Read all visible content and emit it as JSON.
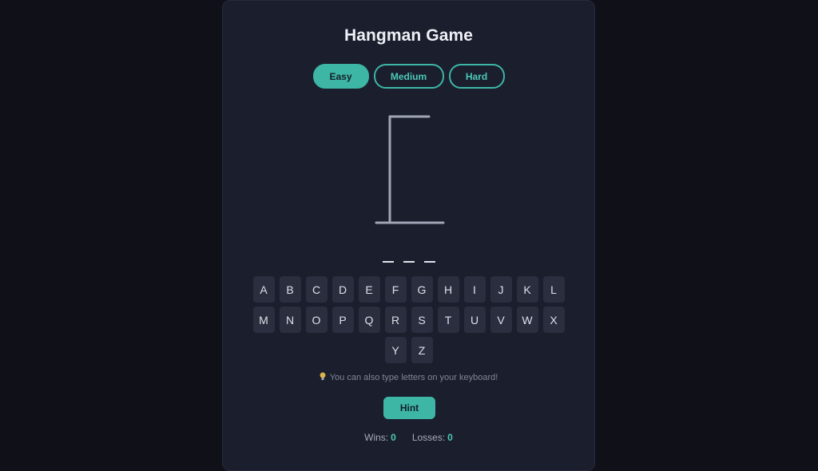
{
  "game": {
    "title": "Hangman Game"
  },
  "difficulty": {
    "options": [
      "Easy",
      "Medium",
      "Hard"
    ],
    "selected": "Easy"
  },
  "word": {
    "letters": [
      "",
      "",
      ""
    ]
  },
  "keyboard": {
    "rows": [
      [
        "A",
        "B",
        "C",
        "D",
        "E",
        "F",
        "G",
        "H",
        "I",
        "J",
        "K",
        "L"
      ],
      [
        "M",
        "N",
        "O",
        "P",
        "Q",
        "R",
        "S",
        "T",
        "U",
        "V",
        "W",
        "X"
      ],
      [
        "Y",
        "Z"
      ]
    ]
  },
  "tip": {
    "icon": "lightbulb-icon",
    "text": "You can also type letters on your keyboard!"
  },
  "hint": {
    "label": "Hint"
  },
  "score": {
    "wins_label": "Wins:",
    "wins": "0",
    "losses_label": "Losses:",
    "losses": "0"
  },
  "colors": {
    "accent": "#3db6a6",
    "background": "#101118",
    "card": "#1b1e2d"
  }
}
